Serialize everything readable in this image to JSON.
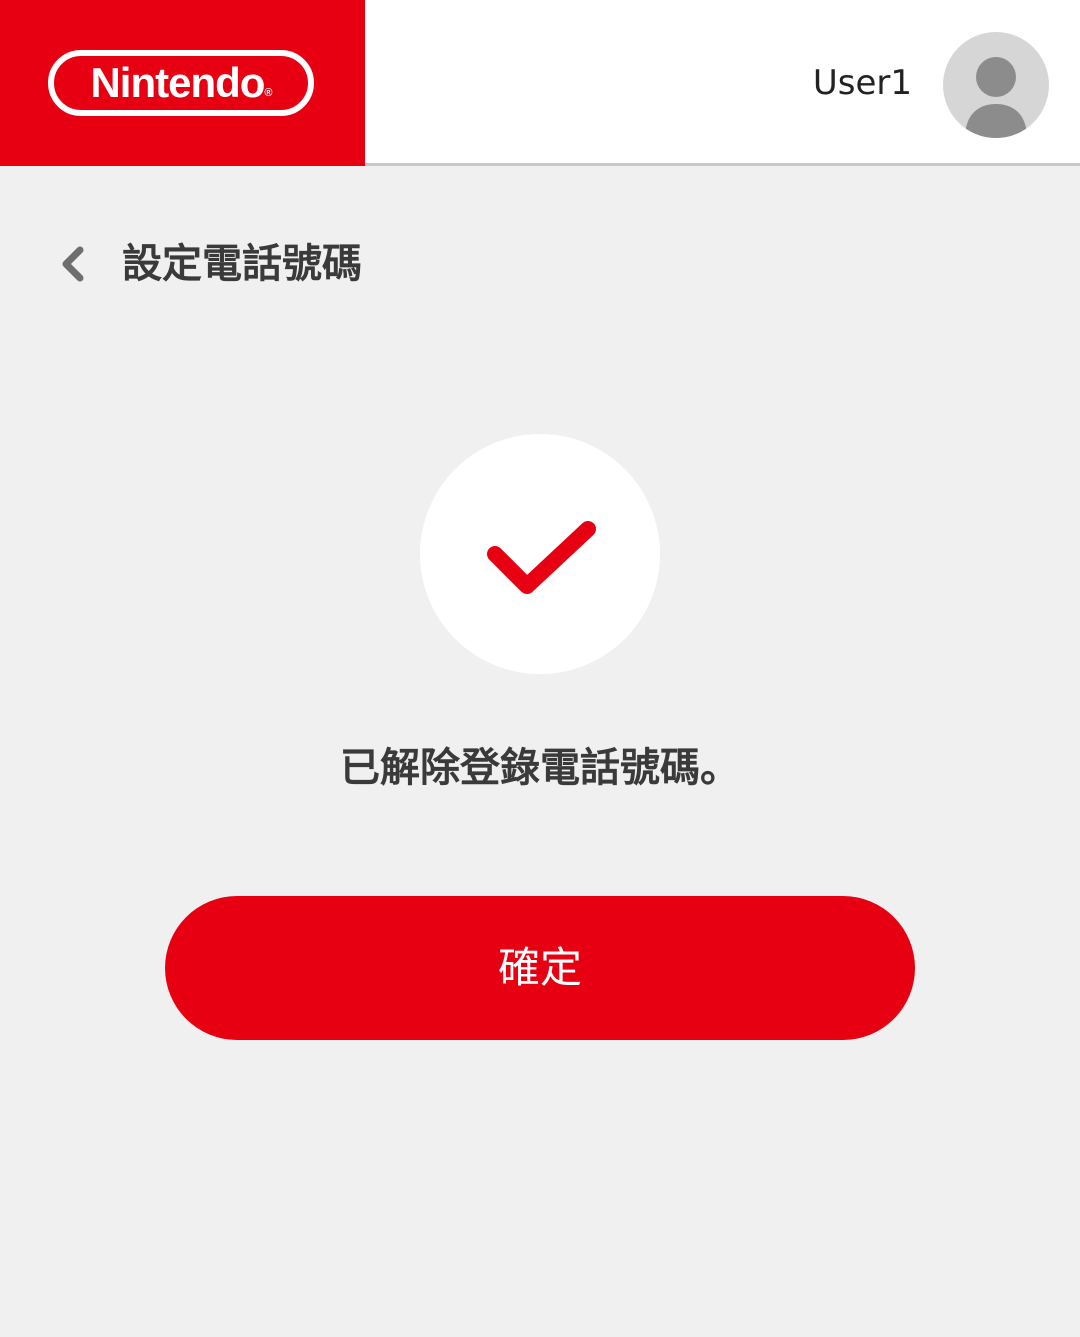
{
  "header": {
    "logo_text": "Nintendo",
    "logo_reg": "®",
    "username": "User1",
    "avatar_icon": "user-avatar-icon"
  },
  "page": {
    "title": "設定電話號碼",
    "back_icon": "chevron-left-icon"
  },
  "status": {
    "icon": "checkmark-icon",
    "message": "已解除登錄電話號碼。"
  },
  "actions": {
    "confirm_label": "確定"
  },
  "colors": {
    "brand_red": "#e60012",
    "background": "#f0f0f0",
    "text_dark": "#3a3a3a",
    "avatar_gray": "#8c8c8c"
  }
}
